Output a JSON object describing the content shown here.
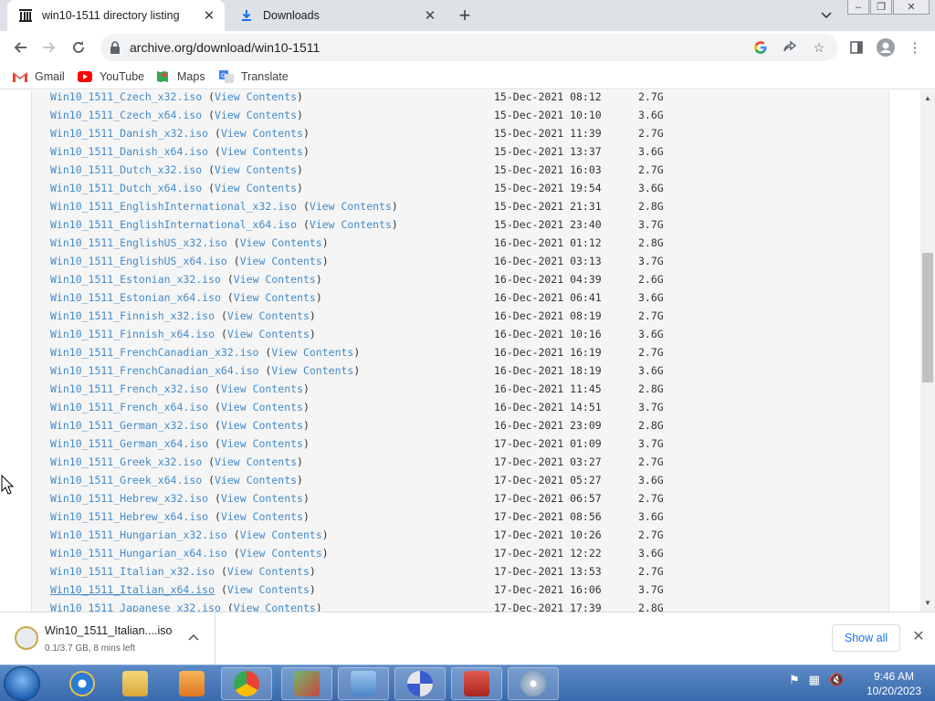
{
  "browser": {
    "tabs": [
      {
        "title": "win10-1511 directory listing",
        "active": true
      },
      {
        "title": "Downloads",
        "active": false
      }
    ],
    "url": "archive.org/download/win10-1511"
  },
  "bookmarks": [
    {
      "label": "Gmail",
      "icon": "gmail-icon"
    },
    {
      "label": "YouTube",
      "icon": "youtube-icon"
    },
    {
      "label": "Maps",
      "icon": "maps-icon"
    },
    {
      "label": "Translate",
      "icon": "translate-icon"
    }
  ],
  "listing": {
    "view_contents_label": "View Contents",
    "rows": [
      {
        "file": "Win10_1511_Czech_x32.iso",
        "date": "15-Dec-2021 08:12",
        "size": "2.7G"
      },
      {
        "file": "Win10_1511_Czech_x64.iso",
        "date": "15-Dec-2021 10:10",
        "size": "3.6G"
      },
      {
        "file": "Win10_1511_Danish_x32.iso",
        "date": "15-Dec-2021 11:39",
        "size": "2.7G"
      },
      {
        "file": "Win10_1511_Danish_x64.iso",
        "date": "15-Dec-2021 13:37",
        "size": "3.6G"
      },
      {
        "file": "Win10_1511_Dutch_x32.iso",
        "date": "15-Dec-2021 16:03",
        "size": "2.7G"
      },
      {
        "file": "Win10_1511_Dutch_x64.iso",
        "date": "15-Dec-2021 19:54",
        "size": "3.6G"
      },
      {
        "file": "Win10_1511_EnglishInternational_x32.iso",
        "date": "15-Dec-2021 21:31",
        "size": "2.8G"
      },
      {
        "file": "Win10_1511_EnglishInternational_x64.iso",
        "date": "15-Dec-2021 23:40",
        "size": "3.7G"
      },
      {
        "file": "Win10_1511_EnglishUS_x32.iso",
        "date": "16-Dec-2021 01:12",
        "size": "2.8G"
      },
      {
        "file": "Win10_1511_EnglishUS_x64.iso",
        "date": "16-Dec-2021 03:13",
        "size": "3.7G"
      },
      {
        "file": "Win10_1511_Estonian_x32.iso",
        "date": "16-Dec-2021 04:39",
        "size": "2.6G"
      },
      {
        "file": "Win10_1511_Estonian_x64.iso",
        "date": "16-Dec-2021 06:41",
        "size": "3.6G"
      },
      {
        "file": "Win10_1511_Finnish_x32.iso",
        "date": "16-Dec-2021 08:19",
        "size": "2.7G"
      },
      {
        "file": "Win10_1511_Finnish_x64.iso",
        "date": "16-Dec-2021 10:16",
        "size": "3.6G"
      },
      {
        "file": "Win10_1511_FrenchCanadian_x32.iso",
        "date": "16-Dec-2021 16:19",
        "size": "2.7G"
      },
      {
        "file": "Win10_1511_FrenchCanadian_x64.iso",
        "date": "16-Dec-2021 18:19",
        "size": "3.6G"
      },
      {
        "file": "Win10_1511_French_x32.iso",
        "date": "16-Dec-2021 11:45",
        "size": "2.8G"
      },
      {
        "file": "Win10_1511_French_x64.iso",
        "date": "16-Dec-2021 14:51",
        "size": "3.7G"
      },
      {
        "file": "Win10_1511_German_x32.iso",
        "date": "16-Dec-2021 23:09",
        "size": "2.8G"
      },
      {
        "file": "Win10_1511_German_x64.iso",
        "date": "17-Dec-2021 01:09",
        "size": "3.7G"
      },
      {
        "file": "Win10_1511_Greek_x32.iso",
        "date": "17-Dec-2021 03:27",
        "size": "2.7G"
      },
      {
        "file": "Win10_1511_Greek_x64.iso",
        "date": "17-Dec-2021 05:27",
        "size": "3.6G"
      },
      {
        "file": "Win10_1511_Hebrew_x32.iso",
        "date": "17-Dec-2021 06:57",
        "size": "2.7G"
      },
      {
        "file": "Win10_1511_Hebrew_x64.iso",
        "date": "17-Dec-2021 08:56",
        "size": "3.6G"
      },
      {
        "file": "Win10_1511_Hungarian_x32.iso",
        "date": "17-Dec-2021 10:26",
        "size": "2.7G"
      },
      {
        "file": "Win10_1511_Hungarian_x64.iso",
        "date": "17-Dec-2021 12:22",
        "size": "3.6G"
      },
      {
        "file": "Win10_1511_Italian_x32.iso",
        "date": "17-Dec-2021 13:53",
        "size": "2.7G"
      },
      {
        "file": "Win10_1511_Italian_x64.iso",
        "date": "17-Dec-2021 16:06",
        "size": "3.7G",
        "hover": true
      },
      {
        "file": "Win10_1511_Japanese_x32.iso",
        "date": "17-Dec-2021 17:39",
        "size": "2.8G"
      }
    ]
  },
  "download_shelf": {
    "filename": "Win10_1511_Italian....iso",
    "status": "0.1/3.7 GB, 8 mins left",
    "show_all": "Show all"
  },
  "taskbar": {
    "time": "9:46 AM",
    "date": "10/20/2023",
    "apps": [
      "internet-explorer-icon",
      "file-explorer-icon",
      "media-player-icon",
      "chrome-icon",
      "network-users-icon",
      "control-panel-icon",
      "settings-gear-icon",
      "toolbox-icon",
      "disc-utility-icon"
    ]
  },
  "colors": {
    "link": "#428bca",
    "accent": "#1a73e8"
  }
}
